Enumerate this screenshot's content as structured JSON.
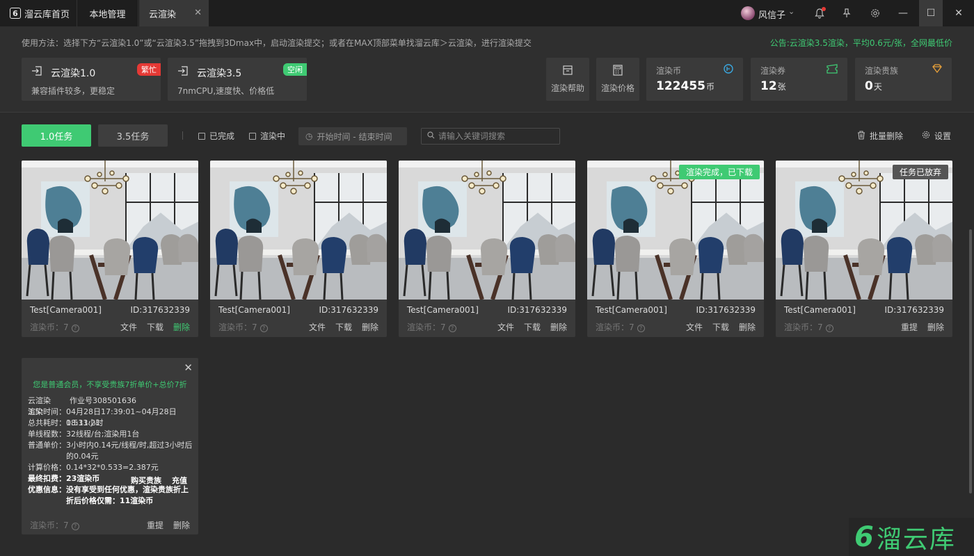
{
  "titlebar": {
    "home_tab": "溜云库首页",
    "local_tab": "本地管理",
    "cloud_tab": "云渲染",
    "username": "风信子"
  },
  "header": {
    "usage": "使用方法：选择下方“云渲染1.0”或“云渲染3.5”拖拽到3Dmax中，启动渲染提交；或者在MAX顶部菜单找溜云库＞云渲染，进行渲染提交",
    "notice": "公告:云渲染3.5渲染，平均0.6元/张，全网最低价",
    "render_cards": [
      {
        "title": "云渲染1.0",
        "desc": "兼容插件较多，更稳定",
        "badge": "繁忙"
      },
      {
        "title": "云渲染3.5",
        "desc": "7nmCPU,速度快、价格低",
        "badge": "空闲"
      }
    ],
    "actions": [
      {
        "label": "渲染帮助"
      },
      {
        "label": "渲染价格"
      }
    ],
    "stats": [
      {
        "label": "渲染币",
        "value": "122455",
        "unit": "币"
      },
      {
        "label": "渲染券",
        "value": "12",
        "unit": "张"
      },
      {
        "label": "渲染贵族",
        "value": "0",
        "unit": "天"
      }
    ]
  },
  "filters": {
    "tab1": "1.0任务",
    "tab2": "3.5任务",
    "done": "已完成",
    "rendering": "渲染中",
    "date_range": "开始时间 - 结束时间",
    "search_placeholder": "请输入关键词搜索",
    "batch_delete": "批量删除",
    "settings": "设置"
  },
  "tasks": [
    {
      "name": "Test[Camera001]",
      "id": "ID:317632339",
      "coin": "渲染币：7",
      "a1": "文件",
      "a2": "下载",
      "a3": "删除",
      "tag": ""
    },
    {
      "name": "Test[Camera001]",
      "id": "ID:317632339",
      "coin": "渲染币：7",
      "a1": "文件",
      "a2": "下载",
      "a3": "删除",
      "tag": ""
    },
    {
      "name": "Test[Camera001]",
      "id": "ID:317632339",
      "coin": "渲染币：7",
      "a1": "文件",
      "a2": "下载",
      "a3": "删除",
      "tag": ""
    },
    {
      "name": "Test[Camera001]",
      "id": "ID:317632339",
      "coin": "渲染币：7",
      "a1": "文件",
      "a2": "下载",
      "a3": "删除",
      "tag": "渲染完成，已下载"
    },
    {
      "name": "Test[Camera001]",
      "id": "ID:317632339",
      "coin": "渲染币：7",
      "a1": "重提",
      "a2": "删除",
      "tag": "任务已放弃"
    }
  ],
  "detail": {
    "notice": "您是普通会员，不享受贵族7折单价+总价7折",
    "r1k": "云渲染3.5：",
    "r1v": "作业号308501636",
    "r2k": "渲染时间：",
    "r2v": "04月28日17:39:01~04月28日18:11:21",
    "r3k": "总共耗时：",
    "r3v": "0.533小时",
    "r4k": "单线程数：",
    "r4v": "32线程/台;渲染用1台",
    "r5k": "普通单价：",
    "r5v": "3小时内0.14元/线程/时,超过3小时后的0.04元",
    "r6k": "计算价格：",
    "r6v": "0.14*32*0.533=2.387元",
    "r7k": "最终扣费：",
    "r7v": "23渲染币",
    "buy_noble": "购买贵族",
    "recharge": "充值",
    "r8k": "优惠信息：",
    "r8v": "没有享受到任何优惠，渲染贵族折上折后价格仅需：11渲染币",
    "coin": "渲染币：7",
    "resubmit": "重提",
    "delete": "删除"
  },
  "brand": {
    "mark": "6",
    "text": "溜云库"
  }
}
